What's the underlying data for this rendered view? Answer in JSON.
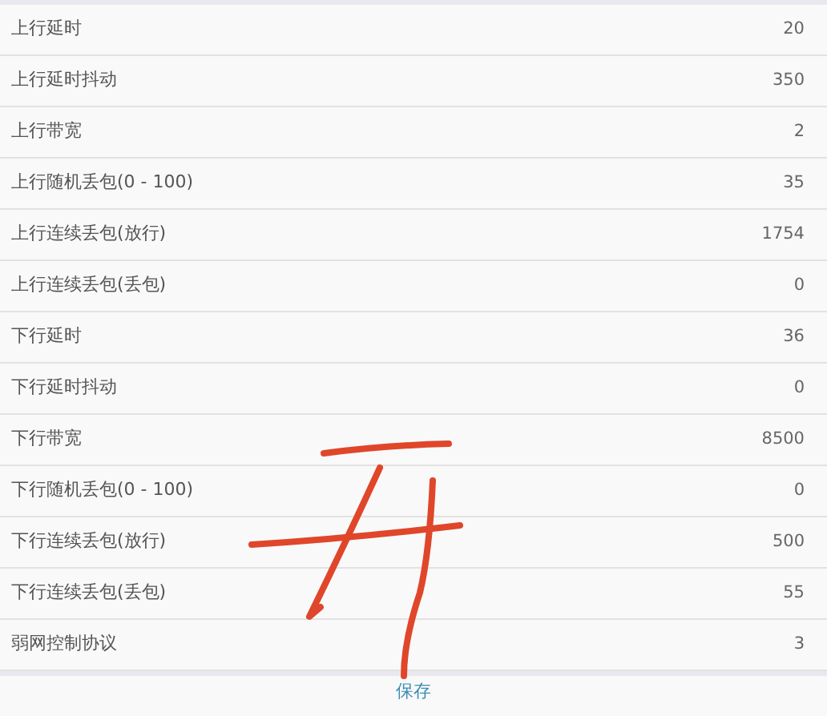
{
  "settings": [
    {
      "label": "上行延时",
      "value": "20"
    },
    {
      "label": "上行延时抖动",
      "value": "350"
    },
    {
      "label": "上行带宽",
      "value": "2"
    },
    {
      "label": "上行随机丢包(0 - 100)",
      "value": "35"
    },
    {
      "label": "上行连续丢包(放行)",
      "value": "1754"
    },
    {
      "label": "上行连续丢包(丢包)",
      "value": "0"
    },
    {
      "label": "下行延时",
      "value": "36"
    },
    {
      "label": "下行延时抖动",
      "value": "0"
    },
    {
      "label": "下行带宽",
      "value": "8500"
    },
    {
      "label": "下行随机丢包(0 - 100)",
      "value": "0"
    },
    {
      "label": "下行连续丢包(放行)",
      "value": "500"
    },
    {
      "label": "下行连续丢包(丢包)",
      "value": "55"
    },
    {
      "label": "弱网控制协议",
      "value": "3"
    }
  ],
  "save_button": "保存"
}
